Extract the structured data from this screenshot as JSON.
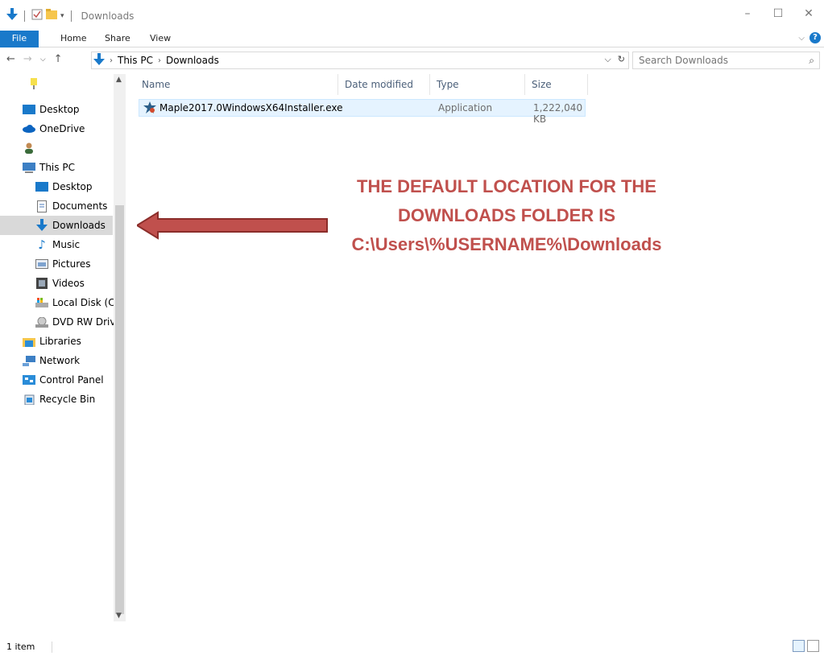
{
  "window": {
    "title": "Downloads",
    "controls": [
      "minimize",
      "maximize",
      "close"
    ]
  },
  "ribbon": {
    "tabs": [
      "File",
      "Home",
      "Share",
      "View"
    ]
  },
  "address": {
    "crumbs": [
      "This PC",
      "Downloads"
    ],
    "search_placeholder": "Search Downloads"
  },
  "nav_pane": {
    "items": [
      {
        "label": "",
        "icon": "pin-icon"
      },
      {
        "label": "Desktop",
        "icon": "desktop-icon"
      },
      {
        "label": "OneDrive",
        "icon": "cloud-icon"
      },
      {
        "label": "",
        "icon": "user-icon"
      },
      {
        "label": "This PC",
        "icon": "computer-icon"
      },
      {
        "label": "Desktop",
        "icon": "desktop-icon"
      },
      {
        "label": "Documents",
        "icon": "document-icon"
      },
      {
        "label": "Downloads",
        "icon": "download-icon"
      },
      {
        "label": "Music",
        "icon": "music-icon"
      },
      {
        "label": "Pictures",
        "icon": "picture-icon"
      },
      {
        "label": "Videos",
        "icon": "video-icon"
      },
      {
        "label": "Local Disk (C:)",
        "icon": "disk-icon"
      },
      {
        "label": "DVD RW Drive",
        "icon": "dvd-icon"
      },
      {
        "label": "Libraries",
        "icon": "library-icon"
      },
      {
        "label": "Network",
        "icon": "network-icon"
      },
      {
        "label": "Control Panel",
        "icon": "control-panel-icon"
      },
      {
        "label": "Recycle Bin",
        "icon": "recycle-bin-icon"
      }
    ],
    "selected": "Downloads"
  },
  "file_list": {
    "columns": [
      "Name",
      "Date modified",
      "Type",
      "Size"
    ],
    "rows": [
      {
        "name": "Maple2017.0WindowsX64Installer.exe",
        "date": "",
        "type": "Application",
        "size": "1,222,040 KB"
      }
    ]
  },
  "annotation": {
    "line1": "THE DEFAULT LOCATION FOR THE",
    "line2": "DOWNLOADS FOLDER IS",
    "line3": "C:\\Users\\%USERNAME%\\Downloads",
    "color": "#c0504d"
  },
  "status": {
    "text": "1 item"
  },
  "colors": {
    "accent": "#1979ca",
    "selection": "#d9d9d9",
    "row_highlight": "#e5f3ff"
  }
}
